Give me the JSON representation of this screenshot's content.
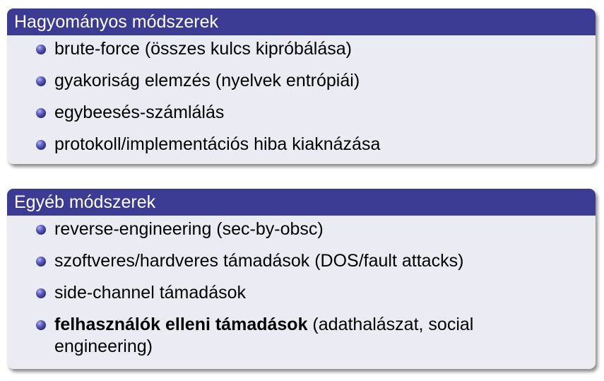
{
  "blocks": [
    {
      "title": "Hagyományos módszerek",
      "items": [
        {
          "text": "brute-force (összes kulcs kipróbálása)"
        },
        {
          "text": "gyakoriság elemzés (nyelvek entrópiái)"
        },
        {
          "text": "egybeesés-számlálás"
        },
        {
          "text": "protokoll/implementációs hiba kiaknázása"
        }
      ]
    },
    {
      "title": "Egyéb módszerek",
      "items": [
        {
          "text": "reverse-engineering (sec-by-obsc)"
        },
        {
          "text": "szoftveres/hardveres támadások (DOS/fault attacks)"
        },
        {
          "text": "side-channel támadások"
        },
        {
          "bold": "felhasználók elleni támadások",
          "text": " (adathalászat, social engineering)"
        }
      ]
    }
  ],
  "colors": {
    "title_bar": "#3b3b93",
    "block_body": "#ebebf3",
    "bullet": "#3b3b93"
  }
}
